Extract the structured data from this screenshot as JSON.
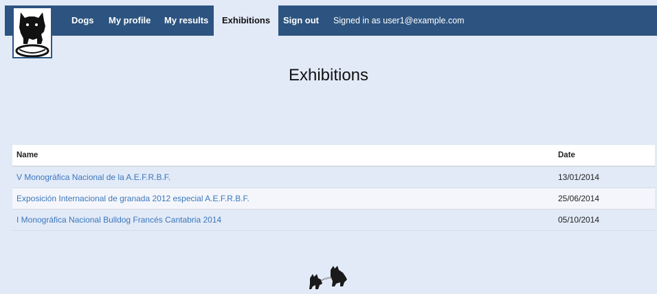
{
  "nav": {
    "items": [
      {
        "label": "Dogs"
      },
      {
        "label": "My profile"
      },
      {
        "label": "My results"
      },
      {
        "label": "Exhibitions"
      },
      {
        "label": "Sign out"
      }
    ],
    "active": "Exhibitions",
    "signed_in_text": "Signed in as user1@example.com",
    "colors": {
      "navbar": "#2d5480",
      "link": "#3b76ba",
      "background": "#e2eaf8"
    }
  },
  "page": {
    "title": "Exhibitions"
  },
  "table": {
    "columns": [
      "Name",
      "Date"
    ],
    "rows": [
      {
        "name": "V Monográfica Nacional de la A.E.F.R.B.F.",
        "date": "13/01/2014"
      },
      {
        "name": "Exposición Internacional de granada 2012 especial A.E.F.R.B.F.",
        "date": "25/06/2014"
      },
      {
        "name": "I Monográfica Nacional Bulldog Francés Cantabria 2014",
        "date": "05/10/2014"
      }
    ]
  },
  "icons": {
    "logo": "french-bulldog-logo",
    "footer": "two-bulldogs-logo"
  }
}
